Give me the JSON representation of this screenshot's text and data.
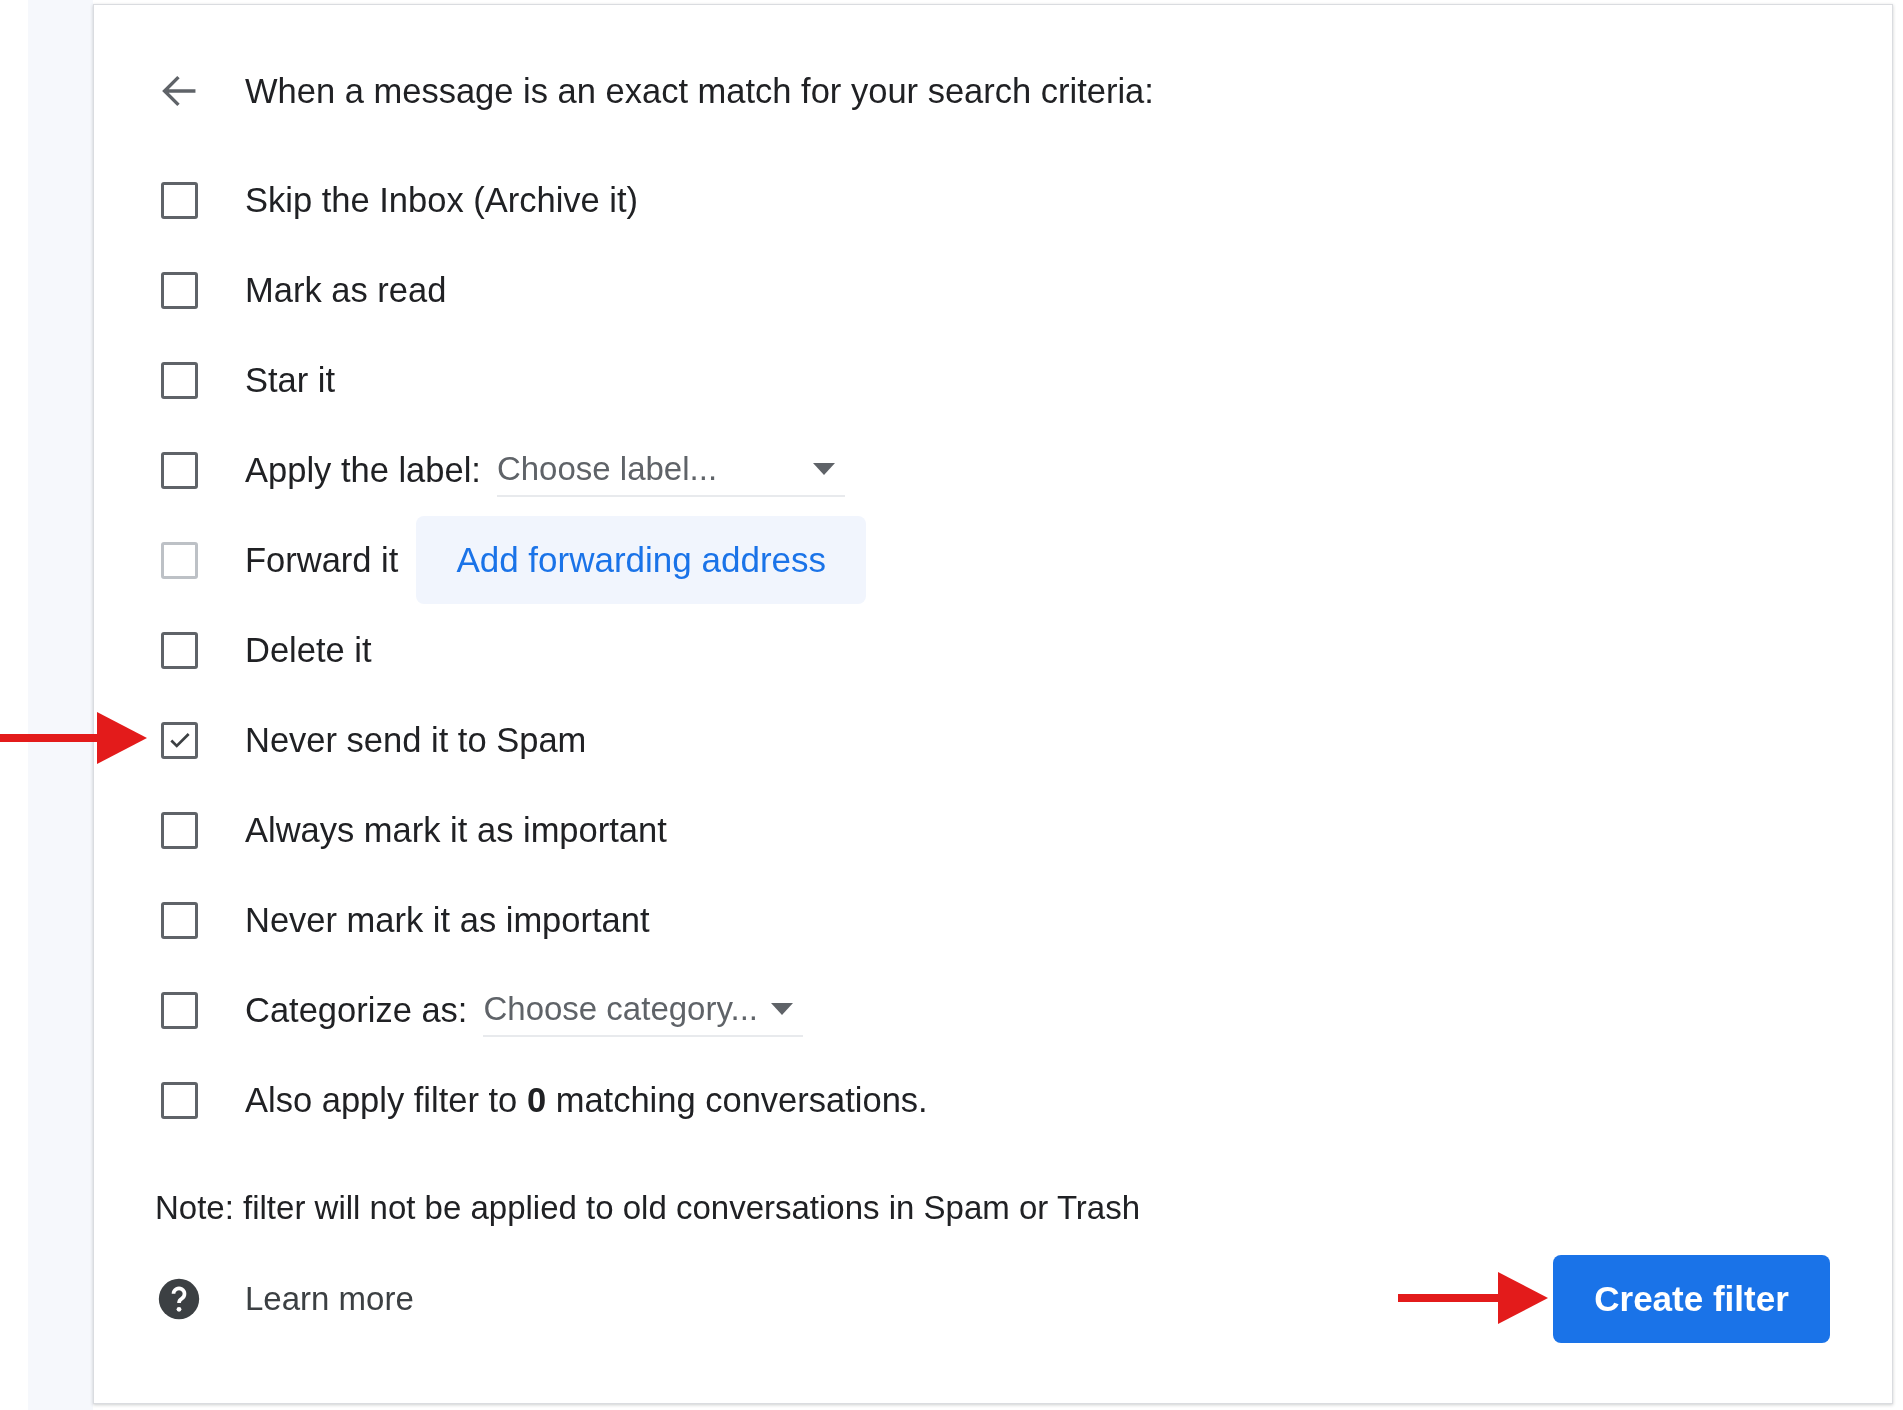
{
  "header": {
    "title": "When a message is an exact match for your search criteria:"
  },
  "options": [
    {
      "kind": "plain",
      "label": "Skip the Inbox (Archive it)",
      "checked": false,
      "disabled": false
    },
    {
      "kind": "plain",
      "label": "Mark as read",
      "checked": false,
      "disabled": false
    },
    {
      "kind": "plain",
      "label": "Star it",
      "checked": false,
      "disabled": false
    },
    {
      "kind": "select",
      "label": "Apply the label:",
      "value": "Choose label...",
      "checked": false,
      "disabled": false
    },
    {
      "kind": "action",
      "label": "Forward it",
      "action": "Add forwarding address",
      "checked": false,
      "disabled": true
    },
    {
      "kind": "plain",
      "label": "Delete it",
      "checked": false,
      "disabled": false
    },
    {
      "kind": "plain",
      "label": "Never send it to Spam",
      "checked": true,
      "disabled": false
    },
    {
      "kind": "plain",
      "label": "Always mark it as important",
      "checked": false,
      "disabled": false
    },
    {
      "kind": "plain",
      "label": "Never mark it as important",
      "checked": false,
      "disabled": false
    },
    {
      "kind": "select",
      "label": "Categorize as:",
      "value": "Choose category...",
      "checked": false,
      "disabled": false
    },
    {
      "kind": "plain",
      "label": "Also apply filter to **0** matching conversations.",
      "checked": false,
      "disabled": false
    }
  ],
  "note": "Note: filter will not be applied to old conversations in Spam or Trash",
  "footer": {
    "learn_more": "Learn more",
    "create_button": "Create filter"
  }
}
